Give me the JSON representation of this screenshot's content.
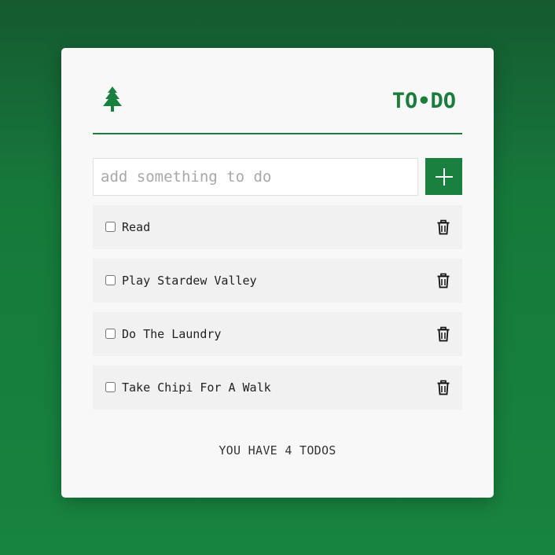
{
  "header": {
    "brand": "TO•DO",
    "logo_icon": "tree-icon"
  },
  "add_form": {
    "placeholder": "add something to do",
    "value": "",
    "button_icon": "plus-icon"
  },
  "todos": [
    {
      "label": "Read",
      "checked": false
    },
    {
      "label": "Play Stardew Valley",
      "checked": false
    },
    {
      "label": "Do The Laundry",
      "checked": false
    },
    {
      "label": "Take Chipi For A Walk",
      "checked": false
    }
  ],
  "footer": {
    "count_text": "YOU HAVE 4 TODOS"
  },
  "colors": {
    "accent": "#1a8040",
    "card_bg": "#f8f8f8",
    "item_bg": "#f1f1f1"
  }
}
